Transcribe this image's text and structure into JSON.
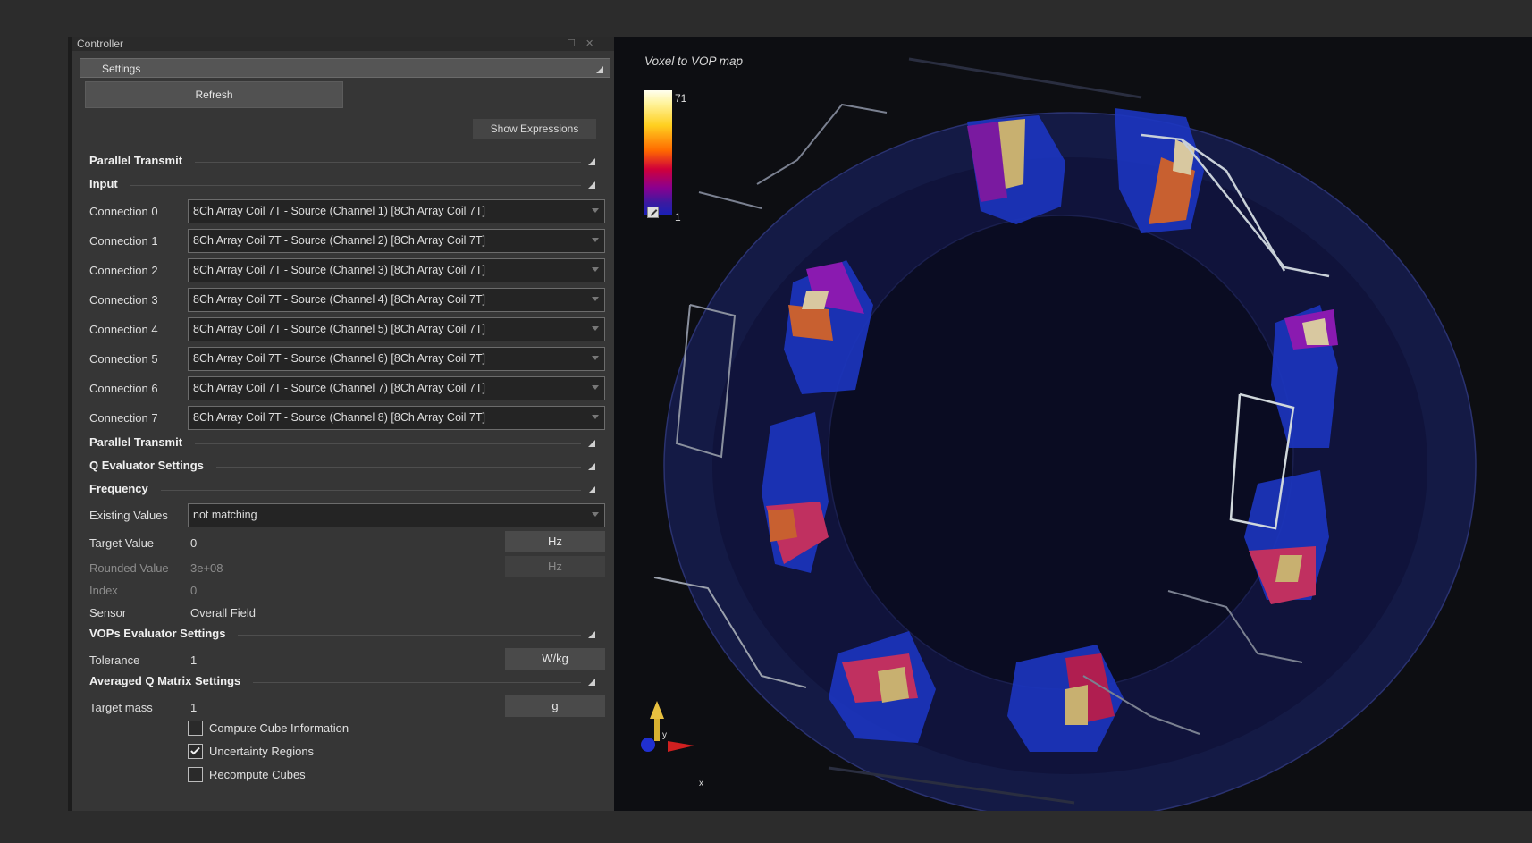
{
  "controller": {
    "title": "Controller",
    "settings_label": "Settings",
    "refresh_label": "Refresh",
    "show_expressions_label": "Show Expressions",
    "sections": {
      "parallel_transmit": "Parallel Transmit",
      "input": "Input",
      "parallel_transmit_2": "Parallel Transmit",
      "q_evaluator": "Q Evaluator Settings",
      "frequency": "Frequency",
      "vops_evaluator": "VOPs Evaluator Settings",
      "averaged_q": "Averaged Q Matrix Settings"
    },
    "connections": [
      {
        "label": "Connection 0",
        "value": "8Ch Array Coil 7T - Source  (Channel 1) [8Ch Array Coil 7T]"
      },
      {
        "label": "Connection 1",
        "value": "8Ch Array Coil 7T - Source  (Channel 2) [8Ch Array Coil 7T]"
      },
      {
        "label": "Connection 2",
        "value": "8Ch Array Coil 7T - Source  (Channel 3) [8Ch Array Coil 7T]"
      },
      {
        "label": "Connection 3",
        "value": "8Ch Array Coil 7T - Source  (Channel 4) [8Ch Array Coil 7T]"
      },
      {
        "label": "Connection 4",
        "value": "8Ch Array Coil 7T - Source  (Channel 5) [8Ch Array Coil 7T]"
      },
      {
        "label": "Connection 5",
        "value": "8Ch Array Coil 7T - Source  (Channel 6) [8Ch Array Coil 7T]"
      },
      {
        "label": "Connection 6",
        "value": "8Ch Array Coil 7T - Source  (Channel 7) [8Ch Array Coil 7T]"
      },
      {
        "label": "Connection 7",
        "value": "8Ch Array Coil 7T - Source  (Channel 8) [8Ch Array Coil 7T]"
      }
    ],
    "frequency": {
      "existing_values_label": "Existing Values",
      "existing_values": "not matching",
      "target_value_label": "Target Value",
      "target_value": "0",
      "target_unit": "Hz",
      "rounded_value_label": "Rounded Value",
      "rounded_value": "3e+08",
      "rounded_unit": "Hz",
      "index_label": "Index",
      "index_value": "0",
      "sensor_label": "Sensor",
      "sensor_value": "Overall Field"
    },
    "vops": {
      "tolerance_label": "Tolerance",
      "tolerance_value": "1",
      "tolerance_unit": "W/kg"
    },
    "averaged_q": {
      "target_mass_label": "Target mass",
      "target_mass_value": "1",
      "target_mass_unit": "g",
      "checkboxes": [
        {
          "label": "Compute Cube Information",
          "checked": false
        },
        {
          "label": "Uncertainty Regions",
          "checked": true
        },
        {
          "label": "Recompute Cubes",
          "checked": false
        }
      ]
    }
  },
  "viewport": {
    "title": "Voxel to VOP map",
    "colorbar_max": "71",
    "colorbar_min": "1",
    "axis_y": "y",
    "axis_x": "x"
  },
  "colors": {
    "panel_bg": "#363636",
    "app_bg": "#2c2c2c",
    "viewport_bg": "#0d0e12",
    "voxel_blue": "#1b2fae"
  }
}
